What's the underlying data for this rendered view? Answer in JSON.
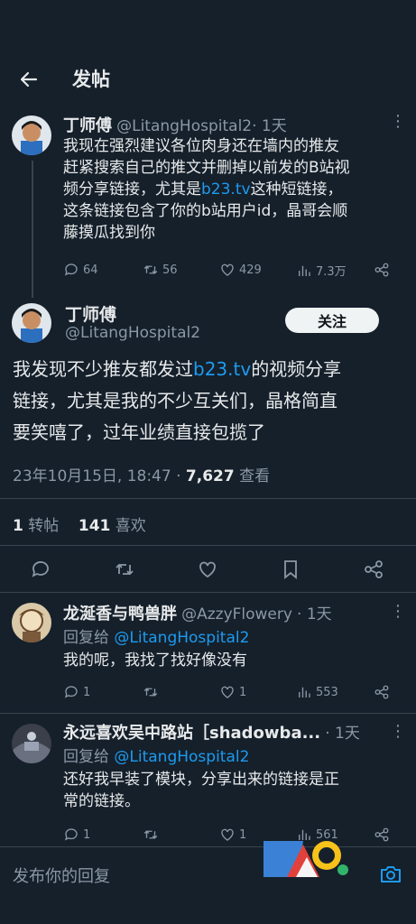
{
  "header": {
    "title": "发帖"
  },
  "parent": {
    "name": "丁师傅",
    "handle": "@LitangHospital2",
    "time": "· 1天",
    "lines": [
      "我现在强烈建议各位肉身还在墙内的推友",
      "赶紧搜索自己的推文并删掉以前发的B站视",
      "频分享链接，尤其是",
      "b23.tv",
      "这种短链接，",
      "这条链接包含了你的b站用户id，晶哥会顺",
      "藤摸瓜找到你"
    ],
    "replies": "64",
    "retweets": "56",
    "likes": "429",
    "views": "7.3万"
  },
  "main": {
    "name": "丁师傅",
    "handle": "@LitangHospital2",
    "follow_label": "关注",
    "text_a": "我发现不少推友都发过",
    "text_link": "b23.tv",
    "text_b": "的视频分享",
    "text_c": "链接，尤其是我的不少互关们，晶格简直",
    "text_d": "要笑嘻了，过年业绩直接包揽了",
    "datetime": "23年10月15日, 18:47 · ",
    "views_count": "7,627",
    "views_label": " 查看",
    "retweet_count": "1",
    "retweet_label": " 转帖",
    "like_count": "141",
    "like_label": " 喜欢"
  },
  "reply1": {
    "name": "龙涎香与鸭兽胖",
    "handle": "@AzzyFlowery",
    "time": "· 1天",
    "reply_prefix": "回复给 ",
    "reply_target": "@LitangHospital2",
    "text": "我的呢，我找了找好像没有",
    "replies": "1",
    "likes": "1",
    "views": "553"
  },
  "reply2": {
    "name": "永远喜欢吴中路站［shadowba...",
    "time": "· 1天",
    "reply_prefix": "回复给 ",
    "reply_target": "@LitangHospital2",
    "text_1": "还好我早装了模块，分享出来的链接是正",
    "text_2": "常的链接。",
    "replies": "1",
    "likes": "1",
    "views": "561"
  },
  "compose": {
    "placeholder": "发布你的回复"
  },
  "colors": {
    "background": "#15202b",
    "link": "#1d9bf0",
    "muted": "#8b98a5",
    "divider": "#38444d"
  }
}
